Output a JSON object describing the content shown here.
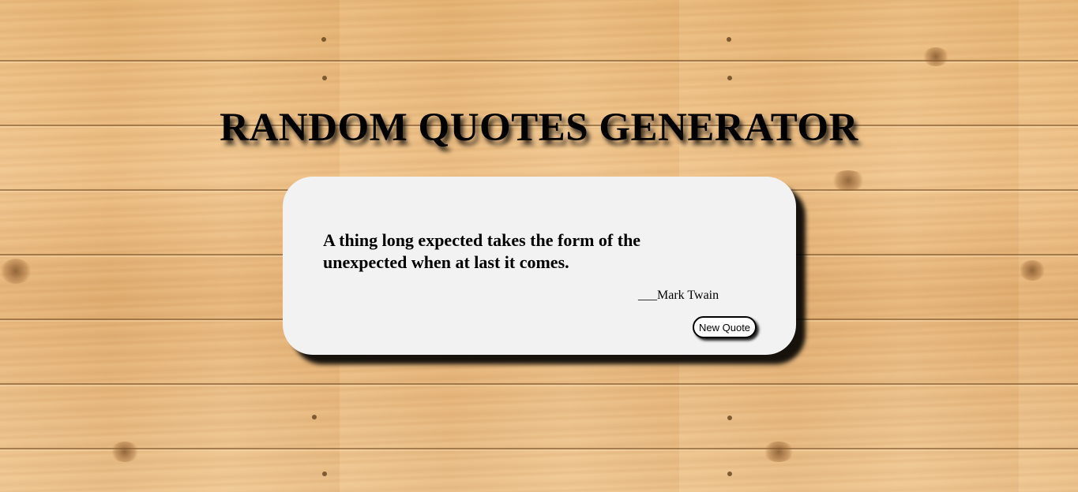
{
  "page": {
    "title": "RANDOM QUOTES GENERATOR"
  },
  "quote": {
    "text": "A thing long expected takes the form of the unexpected when at last it comes.",
    "author_prefix": "___",
    "author": "Mark Twain"
  },
  "actions": {
    "new_quote_label": "New Quote"
  },
  "colors": {
    "card_background": "#f2f2f2",
    "wood": "#e8b77a",
    "text": "#000000"
  }
}
